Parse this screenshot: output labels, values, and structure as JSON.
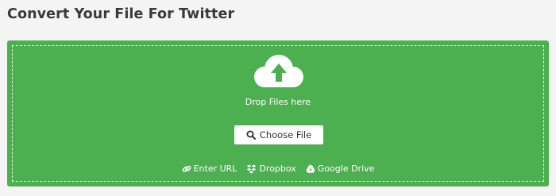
{
  "page": {
    "title": "Convert Your File For Twitter"
  },
  "uploader": {
    "drop_text": "Drop Files here",
    "choose_label": "Choose File",
    "sources": {
      "url_label": "Enter URL",
      "dropbox_label": "Dropbox",
      "gdrive_label": "Google Drive"
    }
  },
  "icons": {
    "upload": "cloud-upload-icon",
    "search": "search-icon",
    "link": "link-icon",
    "dropbox": "dropbox-icon",
    "google_drive": "google-drive-icon"
  },
  "colors": {
    "panel_background": "#4caf50",
    "page_background": "#f4f4f4",
    "title_text": "#3a3a3a",
    "button_background": "#ffffff"
  }
}
